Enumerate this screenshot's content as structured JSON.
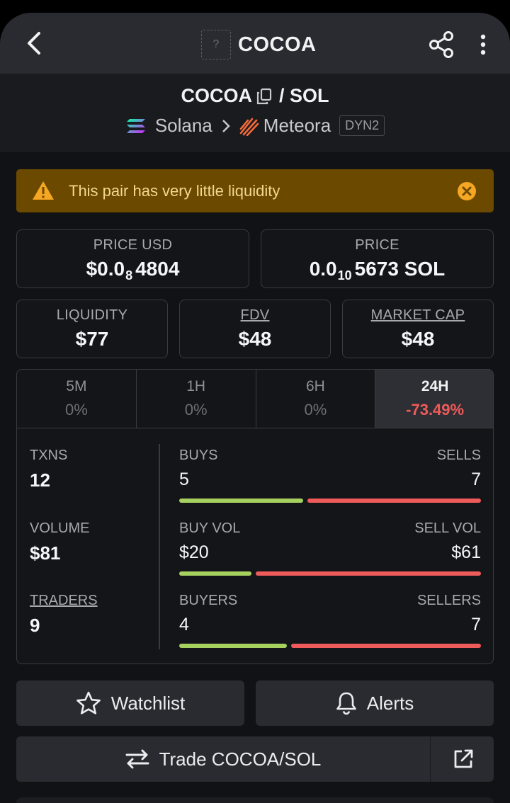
{
  "header": {
    "title": "COCOA",
    "logo_placeholder": "?"
  },
  "pair": {
    "base": "COCOA",
    "separator": "/ SOL",
    "chain": "Solana",
    "dex": "Meteora",
    "dex_type": "DYN2"
  },
  "warning": {
    "text": "This pair has very little liquidity"
  },
  "price_usd": {
    "label": "PRICE USD",
    "prefix": "$0.0",
    "sub": "8",
    "suffix": "4804"
  },
  "price_native": {
    "label": "PRICE",
    "prefix": "0.0",
    "sub": "10",
    "suffix": "5673 SOL"
  },
  "metrics": [
    {
      "label": "LIQUIDITY",
      "value": "$77"
    },
    {
      "label": "FDV",
      "value": "$48"
    },
    {
      "label": "MARKET CAP",
      "value": "$48"
    }
  ],
  "tabs": [
    {
      "label": "5M",
      "value": "0%"
    },
    {
      "label": "1H",
      "value": "0%"
    },
    {
      "label": "6H",
      "value": "0%"
    },
    {
      "label": "24H",
      "value": "-73.49%"
    }
  ],
  "stats": {
    "txns_label": "TXNS",
    "txns": "12",
    "volume_label": "VOLUME",
    "volume": "$81",
    "traders_label": "TRADERS",
    "traders": "9",
    "buys_label": "BUYS",
    "buys": "5",
    "sells_label": "SELLS",
    "sells": "7",
    "buys_fraction": 0.4167,
    "buyvol_label": "BUY VOL",
    "buyvol": "$20",
    "sellvol_label": "SELL VOL",
    "sellvol": "$61",
    "buyvol_fraction": 0.2469,
    "buyers_label": "BUYERS",
    "buyers": "4",
    "sellers_label": "SELLERS",
    "sellers": "7",
    "buyers_fraction": 0.3636
  },
  "actions": {
    "watchlist": "Watchlist",
    "alerts": "Alerts",
    "trade": "Trade COCOA/SOL"
  },
  "colors": {
    "buy": "#a6d15f",
    "sell": "#ef5a5a",
    "warning_bg": "#6b4a00",
    "warning_icon": "#f5a623"
  },
  "icons": [
    "back-icon",
    "share-icon",
    "more-icon",
    "copy-icon",
    "solana-logo-icon",
    "meteora-logo-icon",
    "warning-icon",
    "close-icon",
    "star-icon",
    "bell-icon",
    "swap-icon",
    "external-link-icon"
  ]
}
